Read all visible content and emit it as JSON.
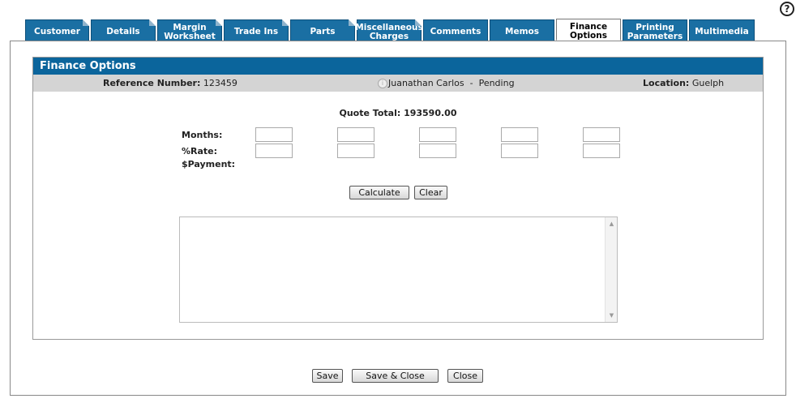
{
  "tabs": [
    {
      "label": "Customer",
      "lines": [
        "Customer"
      ],
      "active": false
    },
    {
      "label": "Details",
      "lines": [
        "Details"
      ],
      "active": false
    },
    {
      "label": "Margin Worksheet",
      "lines": [
        "Margin",
        "Worksheet"
      ],
      "active": false
    },
    {
      "label": "Trade Ins",
      "lines": [
        "Trade Ins"
      ],
      "active": false
    },
    {
      "label": "Parts",
      "lines": [
        "Parts"
      ],
      "active": false
    },
    {
      "label": "Miscellaneous Charges",
      "lines": [
        "Miscellaneous",
        "Charges"
      ],
      "active": false
    },
    {
      "label": "Comments",
      "lines": [
        "Comments"
      ],
      "active": false
    },
    {
      "label": "Memos",
      "lines": [
        "Memos"
      ],
      "active": false
    },
    {
      "label": "Finance Options",
      "lines": [
        "Finance",
        "Options"
      ],
      "active": true
    },
    {
      "label": "Printing Parameters",
      "lines": [
        "Printing",
        "Parameters"
      ],
      "active": false
    },
    {
      "label": "Multimedia",
      "lines": [
        "Multimedia"
      ],
      "active": false
    }
  ],
  "help": {
    "symbol": "?"
  },
  "section": {
    "title": "Finance Options"
  },
  "info": {
    "reference_label": "Reference Number:",
    "reference_value": "123459",
    "customer": "Juanathan Carlos  -  Pending",
    "location_label": "Location:",
    "location_value": "Guelph"
  },
  "quote": {
    "label": "Quote Total:",
    "value": "193590.00",
    "text": "Quote Total: 193590.00"
  },
  "rows": {
    "months": "Months:",
    "rate": "%Rate:",
    "payment": "$Payment:"
  },
  "months_values": [
    "",
    "",
    "",
    "",
    ""
  ],
  "rate_values": [
    "",
    "",
    "",
    "",
    ""
  ],
  "buttons": {
    "calculate": "Calculate",
    "clear": "Clear",
    "save": "Save",
    "save_close": "Save & Close",
    "close": "Close"
  },
  "results": {
    "value": ""
  },
  "colors": {
    "tab_blue": "#1a6fa3",
    "header_blue": "#0b659c",
    "info_gray": "#d4d4d4"
  },
  "icons": {
    "help": "help-circle-icon",
    "info": "info-icon",
    "scroll_up": "scroll-up-icon",
    "scroll_down": "scroll-down-icon"
  }
}
